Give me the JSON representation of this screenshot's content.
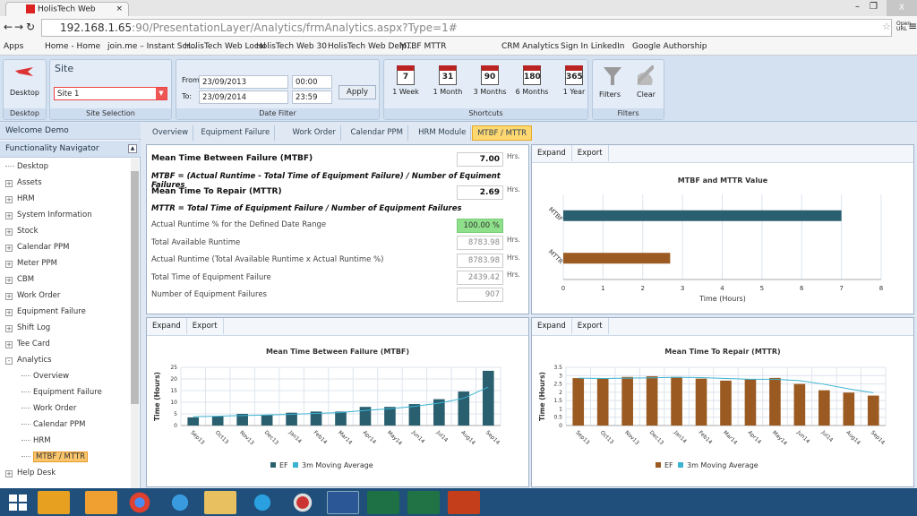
{
  "browser": {
    "tab_title": "HolisTech Web",
    "url_host": "192.168.1.65",
    "url_rest": ":90/PresentationLayer/Analytics/frmAnalytics.aspx?Type=1#",
    "open_url": "Open URL",
    "bookmarks": [
      "Apps",
      "Home - Home",
      "join.me – Instant Scr...",
      "HolisTech Web Local",
      "HolisTech Web 30",
      "HolisTech Web Delp...",
      "MTBF MTTR",
      "CRM Analytics",
      "Sign In  LinkedIn",
      "Google Authorship"
    ]
  },
  "ribbon": {
    "desktop": {
      "label": "Desktop",
      "group": "Desktop"
    },
    "site": {
      "title": "Site",
      "value": "Site 1",
      "group": "Site Selection"
    },
    "date": {
      "from_label": "From:",
      "to_label": "To:",
      "from_date": "23/09/2013",
      "from_time": "00:00",
      "to_date": "23/09/2014",
      "to_time": "23:59",
      "apply": "Apply",
      "group": "Date Filter"
    },
    "shortcuts": {
      "group": "Shortcuts",
      "items": [
        {
          "num": "7",
          "label": "1 Week"
        },
        {
          "num": "31",
          "label": "1 Month"
        },
        {
          "num": "90",
          "label": "3 Months"
        },
        {
          "num": "180",
          "label": "6 Months"
        },
        {
          "num": "365",
          "label": "1 Year"
        }
      ]
    },
    "filters": {
      "group": "Filters",
      "filters": "Filters",
      "clear": "Clear"
    }
  },
  "nav": {
    "welcome": "Welcome Demo",
    "title": "Functionality Navigator",
    "items": [
      "Desktop",
      "Assets",
      "HRM",
      "System Information",
      "Stock",
      "Calendar PPM",
      "Meter PPM",
      "CBM",
      "Work Order",
      "Equipment Failure",
      "Shift Log",
      "Tee Card",
      "Analytics"
    ],
    "sub": [
      "Overview",
      "Equipment Failure",
      "Work Order",
      "Calendar PPM",
      "HRM",
      "MTBF / MTTR"
    ],
    "after": [
      "Help Desk"
    ]
  },
  "tabs": [
    "Overview",
    "Equipment Failure",
    "Work Order",
    "Calendar PPM",
    "HRM Module",
    "MTBF / MTTR"
  ],
  "metrics": {
    "mtbf_label": "Mean Time Between Failure (MTBF)",
    "mtbf": "7.00",
    "mtbf_formula": "MTBF = (Actual Runtime - Total Time of Equipment Failure) / Number of Equiment Failures",
    "mttr_label": "Mean Time To Repair (MTTR)",
    "mttr": "2.69",
    "mttr_formula": "MTTR = Total Time of Equipment Failure / Number of Equipment Failures",
    "runtime_pct_label": "Actual Runtime % for the Defined Date Range",
    "runtime_pct": "100.00 %",
    "avail_label": "Total Available Runtime",
    "avail": "8783.98",
    "actual_label": "Actual Runtime (Total Available Runtime x Actual Runtime %)",
    "actual": "8783.98",
    "fail_time_label": "Total Time of Equipment Failure",
    "fail_time": "2439.42",
    "fail_count_label": "Number of Equipment Failures",
    "fail_count": "907",
    "unit": "Hrs."
  },
  "panel": {
    "expand": "Expand",
    "export": "Export"
  },
  "chart_data": [
    {
      "type": "bar",
      "orientation": "horizontal",
      "title": "MTBF and MTTR Value",
      "categories": [
        "MTBF",
        "MTTR"
      ],
      "values": [
        7.0,
        2.69
      ],
      "colors": [
        "#2a5f70",
        "#9a5a22"
      ],
      "xlabel": "Time (Hours)",
      "xlim": [
        0,
        8
      ],
      "ticks": [
        0,
        1,
        2,
        3,
        4,
        5,
        6,
        7,
        8
      ],
      "grid": true
    },
    {
      "type": "bar",
      "title": "Mean Time Between Failure (MTBF)",
      "ylabel": "Time (Hours)",
      "ylim": [
        0,
        25
      ],
      "ticks": [
        0,
        5,
        10,
        15,
        20,
        25
      ],
      "categories": [
        "Sep13",
        "Oct13",
        "Nov13",
        "Dec13",
        "Jan14",
        "Feb14",
        "Mar14",
        "Apr14",
        "May14",
        "Jun14",
        "Jul14",
        "Aug14",
        "Sep14"
      ],
      "series": [
        {
          "name": "EF",
          "type": "bar",
          "color": "#2a5f70",
          "values": [
            3.5,
            4,
            5,
            4.5,
            5.5,
            6,
            6,
            8,
            8,
            9.2,
            11.3,
            14.6,
            23.5
          ]
        },
        {
          "name": "3m Moving Average",
          "type": "line",
          "color": "#3bb3d0",
          "values": [
            3.8,
            4,
            4.3,
            4.5,
            4.8,
            5.2,
            5.6,
            6.5,
            7.2,
            8.2,
            9.6,
            11.7,
            16.5
          ]
        }
      ],
      "legend": "bottom",
      "grid": true
    },
    {
      "type": "bar",
      "title": "Mean Time To Repair (MTTR)",
      "ylabel": "Time (Hours)",
      "ylim": [
        0,
        3.5
      ],
      "ticks": [
        0,
        0.5,
        1,
        1.5,
        2,
        2.5,
        3,
        3.5
      ],
      "categories": [
        "Sep13",
        "Oct13",
        "Nov13",
        "Dec13",
        "Jan14",
        "Feb14",
        "Mar14",
        "Apr14",
        "May14",
        "Jun14",
        "Jul14",
        "Aug14",
        "Sep14"
      ],
      "series": [
        {
          "name": "EF",
          "type": "bar",
          "color": "#9a5a22",
          "values": [
            2.85,
            2.82,
            2.92,
            2.96,
            2.92,
            2.82,
            2.7,
            2.77,
            2.86,
            2.5,
            2.12,
            1.98,
            1.8
          ]
        },
        {
          "name": "3m Moving Average",
          "type": "line",
          "color": "#3bb3d0",
          "values": [
            2.85,
            2.83,
            2.85,
            2.87,
            2.9,
            2.88,
            2.83,
            2.78,
            2.78,
            2.7,
            2.48,
            2.2,
            1.97
          ]
        }
      ],
      "legend": "bottom",
      "grid": true
    }
  ]
}
